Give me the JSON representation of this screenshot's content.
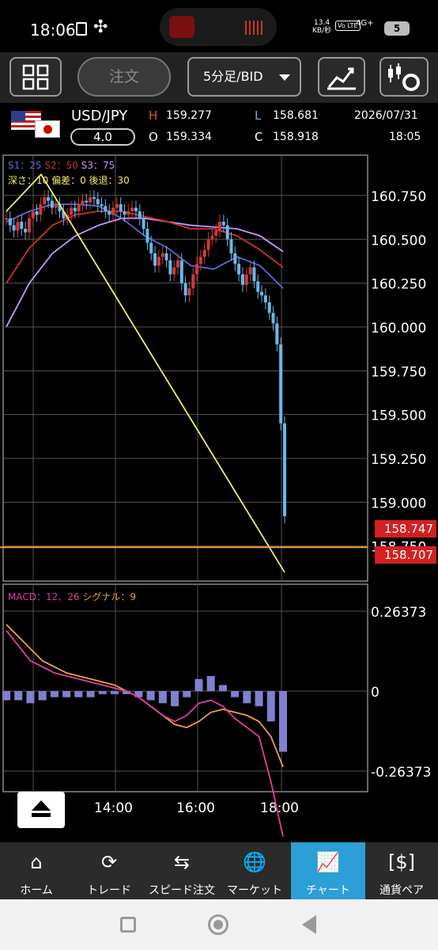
{
  "status_bar": {
    "time": "18:06",
    "net_speed": "13.4",
    "net_unit": "KB/秒",
    "volte": "Vo LTE",
    "signal": "4G+",
    "battery": "5"
  },
  "toolbar": {
    "order_label": "注文",
    "period_label": "5分足/BID"
  },
  "quote": {
    "pair": "USD/JPY",
    "spread": "4.0",
    "high_label": "H",
    "high": "159.277",
    "low_label": "L",
    "low": "158.681",
    "open_label": "O",
    "open": "159.334",
    "close_label": "C",
    "close": "158.918",
    "date": "2026/07/31",
    "time": "18:05"
  },
  "main_legend": {
    "s1": "S1：25",
    "s2": "S2：50",
    "s3": "S3：75",
    "zigzag": "深さ：10 偏差：0 後退：30"
  },
  "macd_legend": {
    "macd": "MACD：12、26",
    "signal": "シグナル：9"
  },
  "price_tags": {
    "bid_line": "158.747",
    "ask_line": "158.707"
  },
  "colors": {
    "s1": "#5a6ad8",
    "s2": "#d03030",
    "s3": "#c89aff",
    "zigzag": "#f0f060",
    "candle_up": "#d03a3a",
    "candle_down": "#6ab8e8",
    "macd": "#e040a0",
    "signal": "#f0a040",
    "hist": "#8080d0",
    "accent": "#2b9fd6"
  },
  "chart_data": [
    {
      "type": "candlestick",
      "title": "",
      "y_ticks": [
        "160.750",
        "160.500",
        "160.250",
        "160.000",
        "159.750",
        "159.500",
        "159.250",
        "159.000",
        "158.750"
      ],
      "x_ticks": [
        "14:00",
        "16:00",
        "18:00"
      ],
      "ylim": [
        158.55,
        160.98
      ],
      "close_series": [
        160.62,
        160.58,
        160.55,
        160.6,
        160.56,
        160.54,
        160.62,
        160.66,
        160.64,
        160.7,
        160.74,
        160.72,
        160.68,
        160.7,
        160.66,
        160.62,
        160.64,
        160.68,
        160.66,
        160.7,
        160.72,
        160.71,
        160.74,
        160.73,
        160.7,
        160.69,
        160.66,
        160.64,
        160.68,
        160.7,
        160.66,
        160.64,
        160.66,
        160.68,
        160.66,
        160.62,
        160.56,
        160.48,
        160.42,
        160.35,
        160.4,
        160.42,
        160.38,
        160.3,
        160.34,
        160.38,
        160.25,
        160.18,
        160.22,
        160.3,
        160.36,
        160.4,
        160.44,
        160.5,
        160.52,
        160.55,
        160.6,
        160.58,
        160.5,
        160.42,
        160.36,
        160.3,
        160.24,
        160.3,
        160.34,
        160.26,
        160.2,
        160.18,
        160.14,
        160.08,
        160.02,
        159.9,
        159.45,
        158.92
      ],
      "zigzag": [
        [
          0,
          160.66
        ],
        [
          10,
          160.87
        ],
        [
          80,
          158.6
        ]
      ],
      "s1_ma": [
        160.6,
        160.66,
        160.7,
        160.7,
        160.69,
        160.62,
        160.52,
        160.45,
        160.35,
        160.33,
        160.4,
        160.35,
        160.22
      ],
      "s2_ma": [
        160.25,
        160.45,
        160.58,
        160.64,
        160.66,
        160.66,
        160.63,
        160.6,
        160.56,
        160.56,
        160.52,
        160.44,
        160.34
      ],
      "s3_ma": [
        160.0,
        160.25,
        160.42,
        160.52,
        160.58,
        160.62,
        160.62,
        160.6,
        160.58,
        160.57,
        160.56,
        160.52,
        160.43
      ]
    },
    {
      "type": "macd",
      "y_ticks": [
        "0.26373",
        "0",
        "-0.26373"
      ],
      "macd_series": [
        0.2,
        0.15,
        0.1,
        0.08,
        0.06,
        0.05,
        0.04,
        0.03,
        0.02,
        0.01,
        0.0,
        -0.02,
        -0.05,
        -0.08,
        -0.1,
        -0.08,
        -0.04,
        -0.03,
        -0.05,
        -0.09,
        -0.12,
        -0.15,
        -0.3,
        -0.48
      ],
      "signal_series": [
        0.22,
        0.18,
        0.14,
        0.1,
        0.08,
        0.06,
        0.05,
        0.04,
        0.03,
        0.02,
        0.0,
        -0.02,
        -0.05,
        -0.08,
        -0.11,
        -0.12,
        -0.1,
        -0.07,
        -0.06,
        -0.07,
        -0.08,
        -0.1,
        -0.15,
        -0.25
      ],
      "hist_series": [
        -0.03,
        -0.03,
        -0.04,
        -0.03,
        -0.02,
        -0.02,
        -0.02,
        -0.02,
        -0.01,
        -0.01,
        -0.01,
        -0.02,
        -0.03,
        -0.04,
        -0.05,
        -0.02,
        0.04,
        0.05,
        0.02,
        -0.02,
        -0.04,
        -0.05,
        -0.1,
        -0.2
      ]
    }
  ],
  "eject_button": "eject-icon",
  "bottom_nav": [
    {
      "label": "ホーム",
      "icon": "home-icon",
      "glyph": "⌂"
    },
    {
      "label": "トレード",
      "icon": "trade-icon",
      "glyph": "⟳"
    },
    {
      "label": "スピード注文",
      "icon": "speed-order-icon",
      "glyph": "⇆"
    },
    {
      "label": "マーケット",
      "icon": "market-icon",
      "glyph": "🌐"
    },
    {
      "label": "チャート",
      "icon": "chart-icon",
      "glyph": "📈"
    },
    {
      "label": "通貨ペア",
      "icon": "currency-pair-icon",
      "glyph": "[$]"
    }
  ]
}
